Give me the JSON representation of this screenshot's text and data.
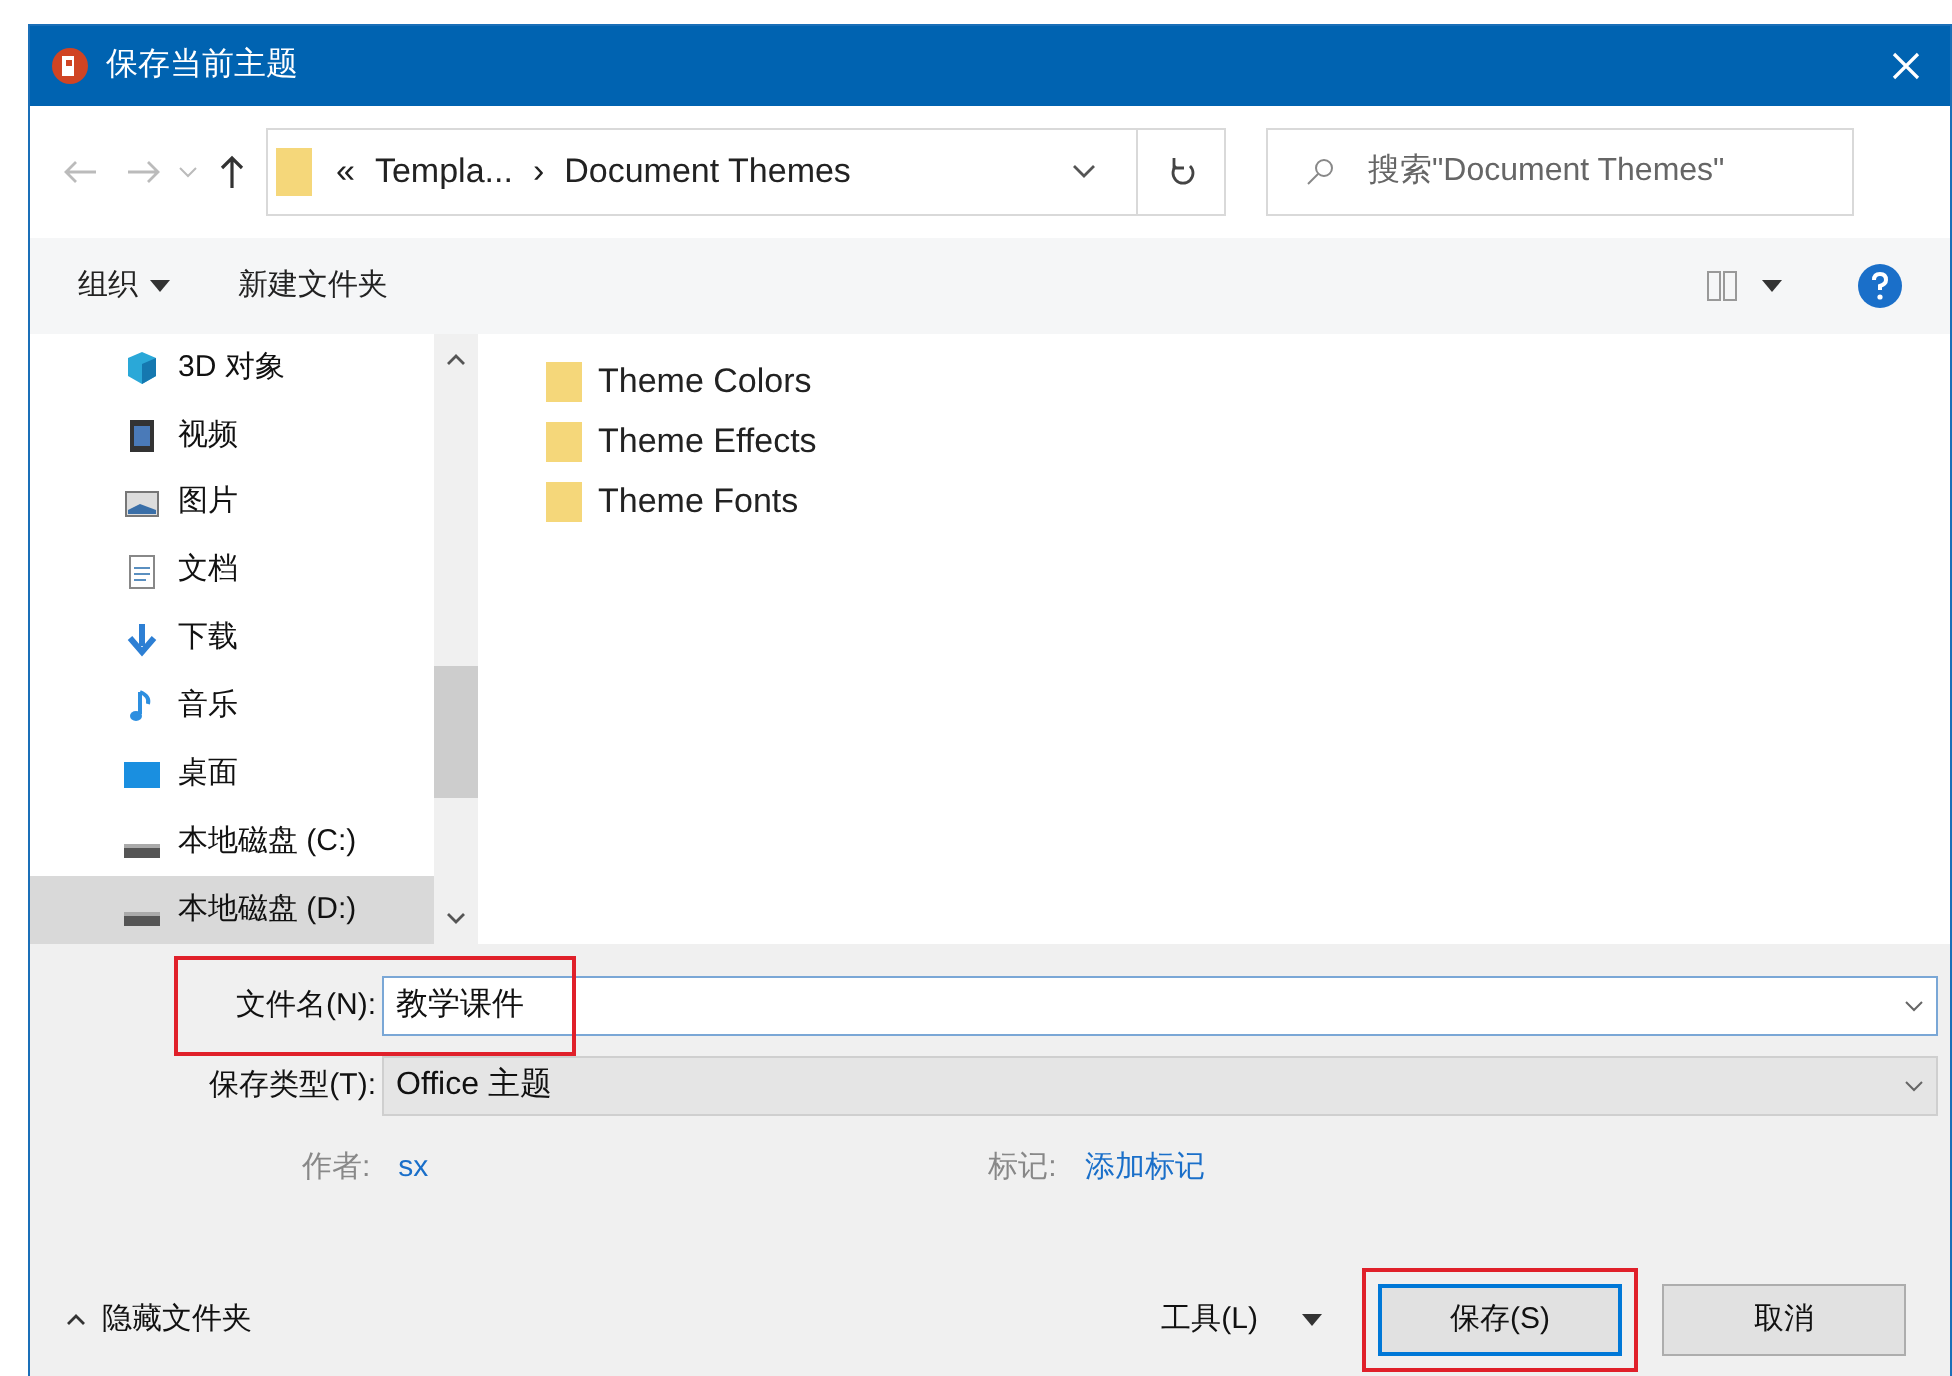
{
  "window": {
    "title": "保存当前主题"
  },
  "address": {
    "crumbs": [
      "«",
      "Templa...",
      "›",
      "Document Themes"
    ],
    "search_placeholder": "搜索\"Document Themes\""
  },
  "toolbar": [
    {
      "label": "组织",
      "kind": "menu"
    },
    {
      "label": "新建文件夹",
      "kind": "button"
    }
  ],
  "sidebar": {
    "items": [
      {
        "label": "3D 对象",
        "kind": "cube",
        "selected": false
      },
      {
        "label": "视频",
        "kind": "video",
        "selected": false
      },
      {
        "label": "图片",
        "kind": "picture",
        "selected": false
      },
      {
        "label": "文档",
        "kind": "document",
        "selected": false
      },
      {
        "label": "下载",
        "kind": "download",
        "selected": false
      },
      {
        "label": "音乐",
        "kind": "music",
        "selected": false
      },
      {
        "label": "桌面",
        "kind": "desktop",
        "selected": false
      },
      {
        "label": "本地磁盘 (C:)",
        "kind": "drive",
        "selected": false
      },
      {
        "label": "本地磁盘 (D:)",
        "kind": "drive",
        "selected": true
      }
    ]
  },
  "files": [
    "Theme Colors",
    "Theme Effects",
    "Theme Fonts"
  ],
  "form": {
    "filename": {
      "label": "文件名(N):",
      "value": "教学课件",
      "highlighted": true
    },
    "filetype": {
      "label": "保存类型(T):",
      "value": "Office 主题"
    }
  },
  "meta": [
    {
      "label": "作者:",
      "value": "sx"
    },
    {
      "label": "标记:",
      "value": "添加标记"
    }
  ],
  "footer": {
    "hide_folders": "隐藏文件夹",
    "tools": "工具(L)",
    "buttons": [
      {
        "label": "保存(S)",
        "default": true,
        "highlighted": true
      },
      {
        "label": "取消",
        "default": false,
        "highlighted": false
      }
    ]
  }
}
